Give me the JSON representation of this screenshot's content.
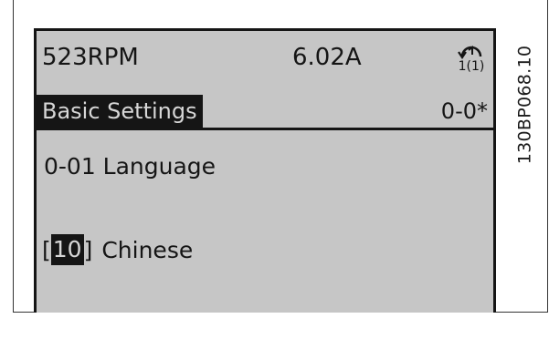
{
  "reference_code": "130BP068.10",
  "status": {
    "speed": "523RPM",
    "current": "6.02A",
    "setup_icon": "setup-1-icon",
    "setup_number": "1(1)"
  },
  "group": {
    "name": "Basic Settings",
    "code": "0-0*"
  },
  "parameter": {
    "label": "0-01 Language"
  },
  "value": {
    "open_bracket": "[",
    "index": "10",
    "close_bracket": "]",
    "name": "Chinese"
  },
  "colors": {
    "lcd_background": "#c6c6c6",
    "lcd_foreground": "#151515"
  }
}
